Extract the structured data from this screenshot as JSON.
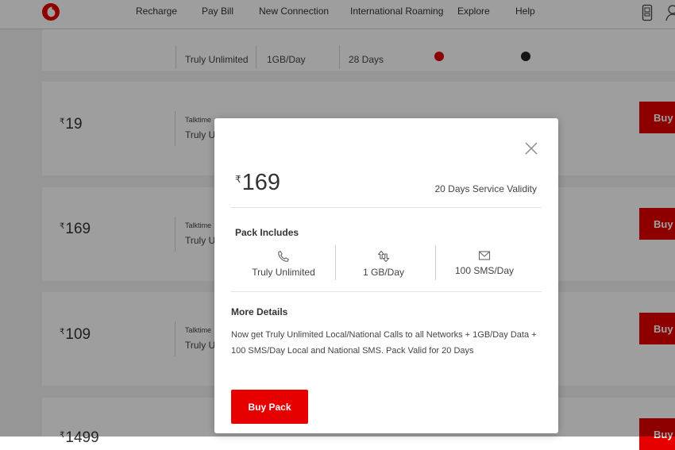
{
  "nav": {
    "items": [
      "Recharge",
      "Pay Bill",
      "New Connection",
      "International Roaming",
      "Explore",
      "Help"
    ]
  },
  "brand_color": "#e60000",
  "icons": {
    "logo": "vodafone-logo-icon",
    "sim": "sim-card-icon",
    "user": "user-icon",
    "close": "close-icon",
    "call": "phone-icon",
    "data": "data-transfer-icon",
    "sms": "envelope-icon"
  },
  "background_cards": [
    {
      "price": "",
      "label": "",
      "talktime": "Truly Unlimited",
      "data": "1GB/Day",
      "validity": "28 Days",
      "button": ""
    },
    {
      "price": "19",
      "label": "Talktime",
      "talktime": "Truly Un",
      "button": "Buy"
    },
    {
      "price": "169",
      "label": "Talktime",
      "talktime": "Truly Un",
      "button": "Buy"
    },
    {
      "price": "109",
      "label": "Talktime",
      "talktime": "Truly Un",
      "button": "Buy"
    },
    {
      "price": "1499",
      "label": "",
      "talktime": "",
      "button": "Buy"
    }
  ],
  "modal": {
    "currency": "₹",
    "price": "169",
    "validity": "20 Days Service Validity",
    "pack_includes_title": "Pack Includes",
    "benefits": [
      {
        "label": "Truly Unlimited",
        "icon": "phone-icon"
      },
      {
        "label": "1 GB/Day",
        "icon": "data-transfer-icon"
      },
      {
        "label": "100 SMS/Day",
        "icon": "envelope-icon"
      }
    ],
    "more_details_title": "More Details",
    "details_text": "Now get Truly Unlimited Local/National Calls to all Networks + 1GB/Day Data + 100 SMS/Day Local and National SMS. Pack Valid for 20 Days",
    "buy_button": "Buy Pack"
  }
}
